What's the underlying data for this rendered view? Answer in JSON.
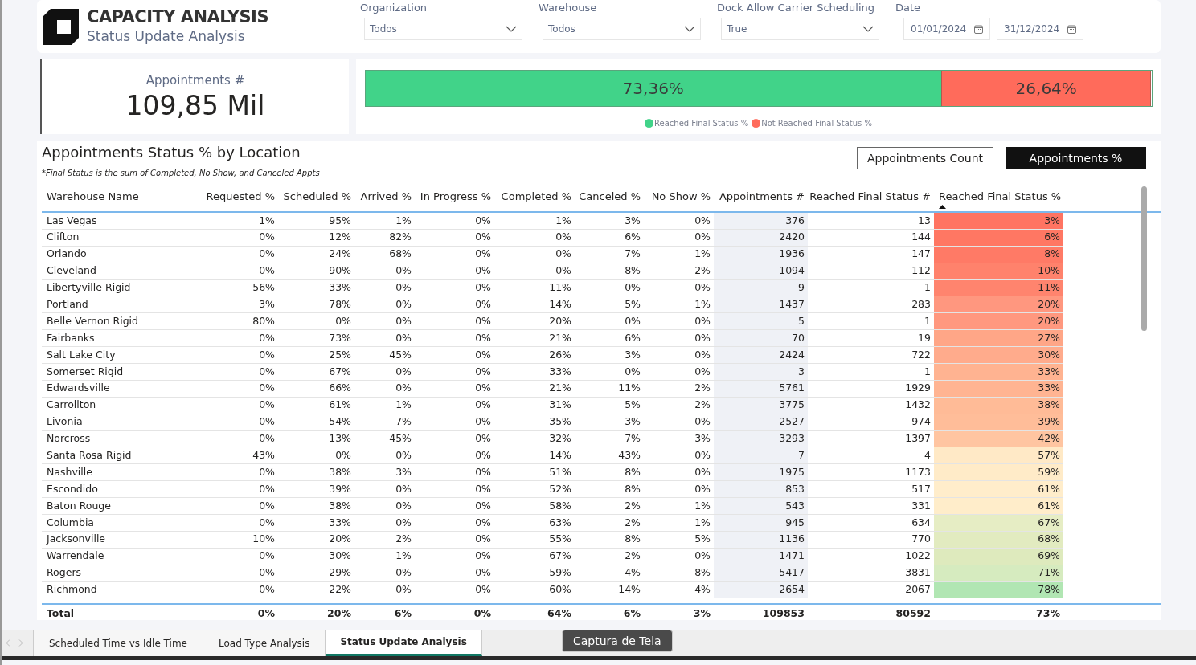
{
  "header": {
    "title": "CAPACITY ANALYSIS",
    "subtitle": "Status Update Analysis"
  },
  "filters": [
    {
      "kind": "dropdown",
      "label": "Organization",
      "value": "Todos"
    },
    {
      "kind": "dropdown",
      "label": "Warehouse",
      "value": "Todos"
    },
    {
      "kind": "dropdown",
      "label": "Dock Allow Carrier Scheduling",
      "value": "True"
    },
    {
      "kind": "dates",
      "label": "Date",
      "start": "01/01/2024",
      "end": "31/12/2024"
    }
  ],
  "kpi": {
    "label": "Appointments #",
    "value": "109,85 Mil"
  },
  "status_bar": {
    "segments": [
      {
        "name": "Reached Final Status %",
        "color": "#41d389",
        "share": "73,36%",
        "level": 0.7336
      },
      {
        "name": "Not Reached Final Status %",
        "color": "#ff6b5b",
        "share": "26,64%",
        "level": 0.2664
      }
    ]
  },
  "table_panel": {
    "title": "Appointments Status % by Location",
    "note": "*Final Status is the sum of Completed, No Show, and Canceled Appts",
    "toggles": [
      {
        "label": "Appointments Count",
        "selected": false
      },
      {
        "label": "Appointments %",
        "selected": true
      }
    ],
    "columns": [
      "Warehouse Name",
      "Requested %",
      "Scheduled %",
      "Arrived %",
      "In Progress %",
      "Completed %",
      "Canceled %",
      "No Show %",
      "Appointments #",
      "Reached Final Status #",
      "Reached Final Status %"
    ],
    "rows": [
      {
        "cells": [
          "Las Vegas",
          "1%",
          "95%",
          "1%",
          "0%",
          "1%",
          "3%",
          "0%",
          "376",
          "13",
          "3%"
        ],
        "color": "#ff7462"
      },
      {
        "cells": [
          "Clifton",
          "0%",
          "12%",
          "82%",
          "0%",
          "0%",
          "6%",
          "0%",
          "2420",
          "144",
          "6%"
        ],
        "color": "#ff7763"
      },
      {
        "cells": [
          "Orlando",
          "0%",
          "24%",
          "68%",
          "0%",
          "0%",
          "7%",
          "1%",
          "1936",
          "147",
          "8%"
        ],
        "color": "#ff7a66"
      },
      {
        "cells": [
          "Cleveland",
          "0%",
          "90%",
          "0%",
          "0%",
          "0%",
          "8%",
          "2%",
          "1094",
          "112",
          "10%"
        ],
        "color": "#ff826c"
      },
      {
        "cells": [
          "Libertyville Rigid",
          "56%",
          "33%",
          "0%",
          "0%",
          "11%",
          "0%",
          "0%",
          "9",
          "1",
          "11%"
        ],
        "color": "#ff846e"
      },
      {
        "cells": [
          "Portland",
          "3%",
          "78%",
          "0%",
          "0%",
          "14%",
          "5%",
          "1%",
          "1437",
          "283",
          "20%"
        ],
        "color": "#ff977f"
      },
      {
        "cells": [
          "Belle Vernon Rigid",
          "80%",
          "0%",
          "0%",
          "0%",
          "20%",
          "0%",
          "0%",
          "5",
          "1",
          "20%"
        ],
        "color": "#ff987f"
      },
      {
        "cells": [
          "Fairbanks",
          "0%",
          "73%",
          "0%",
          "0%",
          "21%",
          "6%",
          "0%",
          "70",
          "19",
          "27%"
        ],
        "color": "#ffa687"
      },
      {
        "cells": [
          "Salt Lake City",
          "0%",
          "25%",
          "45%",
          "0%",
          "26%",
          "3%",
          "0%",
          "2424",
          "722",
          "30%"
        ],
        "color": "#ffab8c"
      },
      {
        "cells": [
          "Somerset Rigid",
          "0%",
          "67%",
          "0%",
          "0%",
          "33%",
          "0%",
          "0%",
          "3",
          "1",
          "33%"
        ],
        "color": "#ffb391"
      },
      {
        "cells": [
          "Edwardsville",
          "0%",
          "66%",
          "0%",
          "0%",
          "21%",
          "11%",
          "2%",
          "5761",
          "1929",
          "33%"
        ],
        "color": "#ffb492"
      },
      {
        "cells": [
          "Carrollton",
          "0%",
          "61%",
          "1%",
          "0%",
          "31%",
          "5%",
          "2%",
          "3775",
          "1432",
          "38%"
        ],
        "color": "#ffbb97"
      },
      {
        "cells": [
          "Livonia",
          "0%",
          "54%",
          "7%",
          "0%",
          "35%",
          "3%",
          "0%",
          "2527",
          "974",
          "39%"
        ],
        "color": "#ffbd99"
      },
      {
        "cells": [
          "Norcross",
          "0%",
          "13%",
          "45%",
          "0%",
          "32%",
          "7%",
          "3%",
          "3293",
          "1397",
          "42%"
        ],
        "color": "#ffc5a1"
      },
      {
        "cells": [
          "Santa Rosa Rigid",
          "43%",
          "0%",
          "0%",
          "0%",
          "14%",
          "43%",
          "0%",
          "7",
          "4",
          "57%"
        ],
        "color": "#ffe9c6"
      },
      {
        "cells": [
          "Nashville",
          "0%",
          "38%",
          "3%",
          "0%",
          "51%",
          "8%",
          "0%",
          "1975",
          "1173",
          "59%"
        ],
        "color": "#ffebc8"
      },
      {
        "cells": [
          "Escondido",
          "0%",
          "39%",
          "0%",
          "0%",
          "52%",
          "8%",
          "0%",
          "853",
          "517",
          "61%"
        ],
        "color": "#ffedcb"
      },
      {
        "cells": [
          "Baton Rouge",
          "0%",
          "38%",
          "0%",
          "0%",
          "58%",
          "2%",
          "1%",
          "543",
          "331",
          "61%"
        ],
        "color": "#ffedca"
      },
      {
        "cells": [
          "Columbia",
          "0%",
          "33%",
          "0%",
          "0%",
          "63%",
          "2%",
          "1%",
          "945",
          "634",
          "67%"
        ],
        "color": "#e6edc4"
      },
      {
        "cells": [
          "Jacksonville",
          "10%",
          "20%",
          "2%",
          "0%",
          "55%",
          "8%",
          "5%",
          "1136",
          "770",
          "68%"
        ],
        "color": "#e2ebc0"
      },
      {
        "cells": [
          "Warrendale",
          "0%",
          "30%",
          "1%",
          "0%",
          "67%",
          "2%",
          "0%",
          "1471",
          "1022",
          "69%"
        ],
        "color": "#deeabd"
      },
      {
        "cells": [
          "Rogers",
          "0%",
          "29%",
          "0%",
          "0%",
          "59%",
          "4%",
          "8%",
          "5417",
          "3831",
          "71%"
        ],
        "color": "#d6ebbf"
      },
      {
        "cells": [
          "Richmond",
          "0%",
          "22%",
          "0%",
          "0%",
          "60%",
          "14%",
          "4%",
          "2654",
          "2067",
          "78%"
        ],
        "color": "#b1e6b3"
      }
    ],
    "total": [
      "Total",
      "0%",
      "20%",
      "6%",
      "0%",
      "64%",
      "6%",
      "3%",
      "109853",
      "80592",
      "73%"
    ]
  },
  "page_tabs": [
    {
      "label": "Scheduled Time vs Idle Time",
      "selected": false
    },
    {
      "label": "Load Type Analysis",
      "selected": false
    },
    {
      "label": "Status Update Analysis",
      "selected": true
    }
  ],
  "tooltip": "Captura de Tela"
}
